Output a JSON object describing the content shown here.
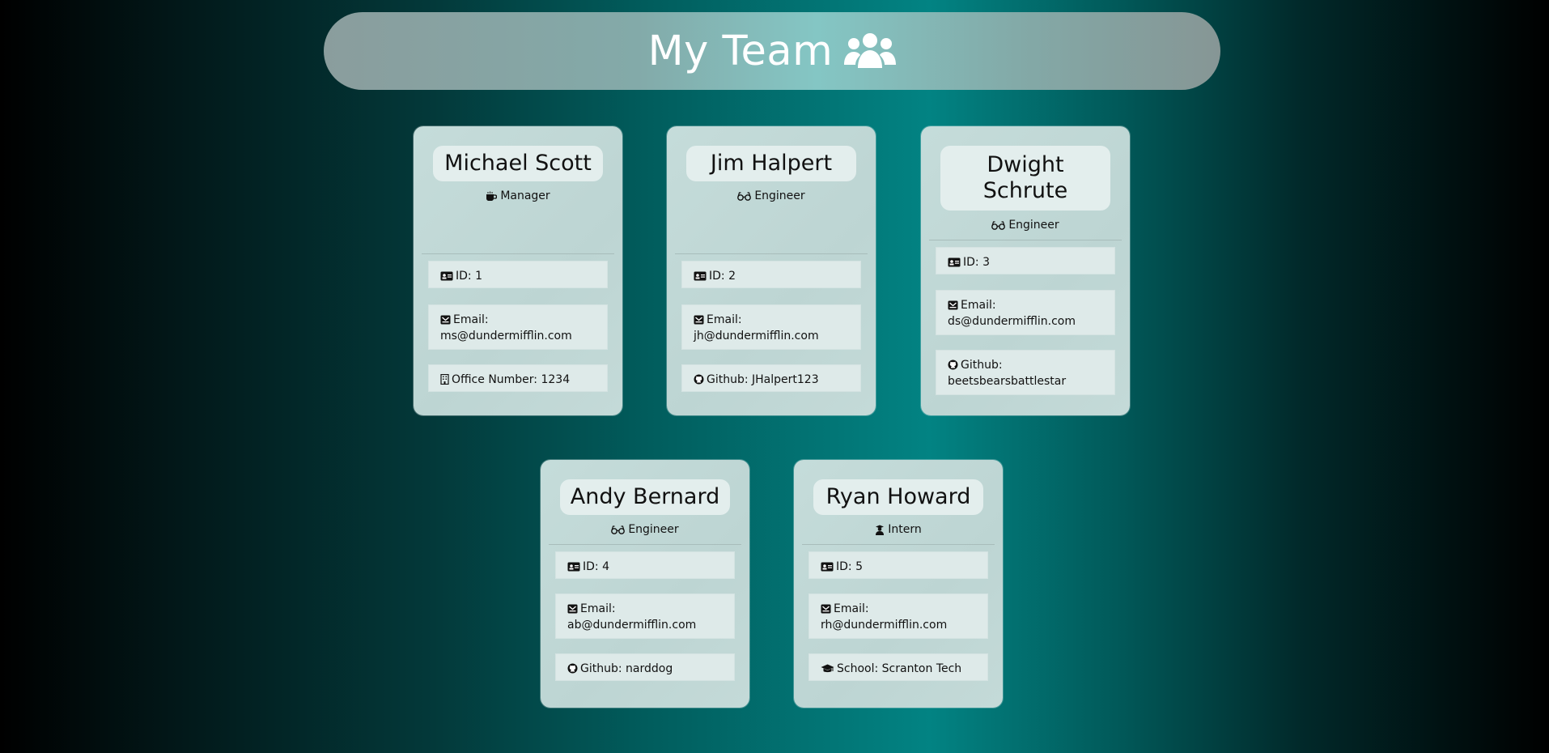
{
  "header": {
    "title": "My Team",
    "icon": "users-icon"
  },
  "cards": [
    {
      "name": "Michael Scott",
      "role": "Manager",
      "role_icon": "coffee-icon",
      "id": "ID: 1",
      "email_label": "Email:",
      "email": "ms@dundermifflin.com",
      "extra": "Office Number: 1234",
      "extra_icon": "building-icon"
    },
    {
      "name": "Jim Halpert",
      "role": "Engineer",
      "role_icon": "glasses-icon",
      "id": "ID: 2",
      "email_label": "Email:",
      "email": "jh@dundermifflin.com",
      "extra": "Github: JHalpert123",
      "extra_icon": "github-icon"
    },
    {
      "name": "Dwight Schrute",
      "role": "Engineer",
      "role_icon": "glasses-icon",
      "id": "ID: 3",
      "email_label": "Email:",
      "email": "ds@dundermifflin.com",
      "extra_label": "Github:",
      "extra_value": "beetsbearsbattlestar",
      "extra_icon": "github-icon"
    },
    {
      "name": "Andy Bernard",
      "role": "Engineer",
      "role_icon": "glasses-icon",
      "id": "ID: 4",
      "email_label": "Email:",
      "email": "ab@dundermifflin.com",
      "extra": "Github: narddog",
      "extra_icon": "github-icon"
    },
    {
      "name": "Ryan Howard",
      "role": "Intern",
      "role_icon": "graduate-icon",
      "id": "ID: 5",
      "email_label": "Email:",
      "email": "rh@dundermifflin.com",
      "extra": "School: Scranton Tech",
      "extra_icon": "graduation-cap-icon"
    }
  ]
}
